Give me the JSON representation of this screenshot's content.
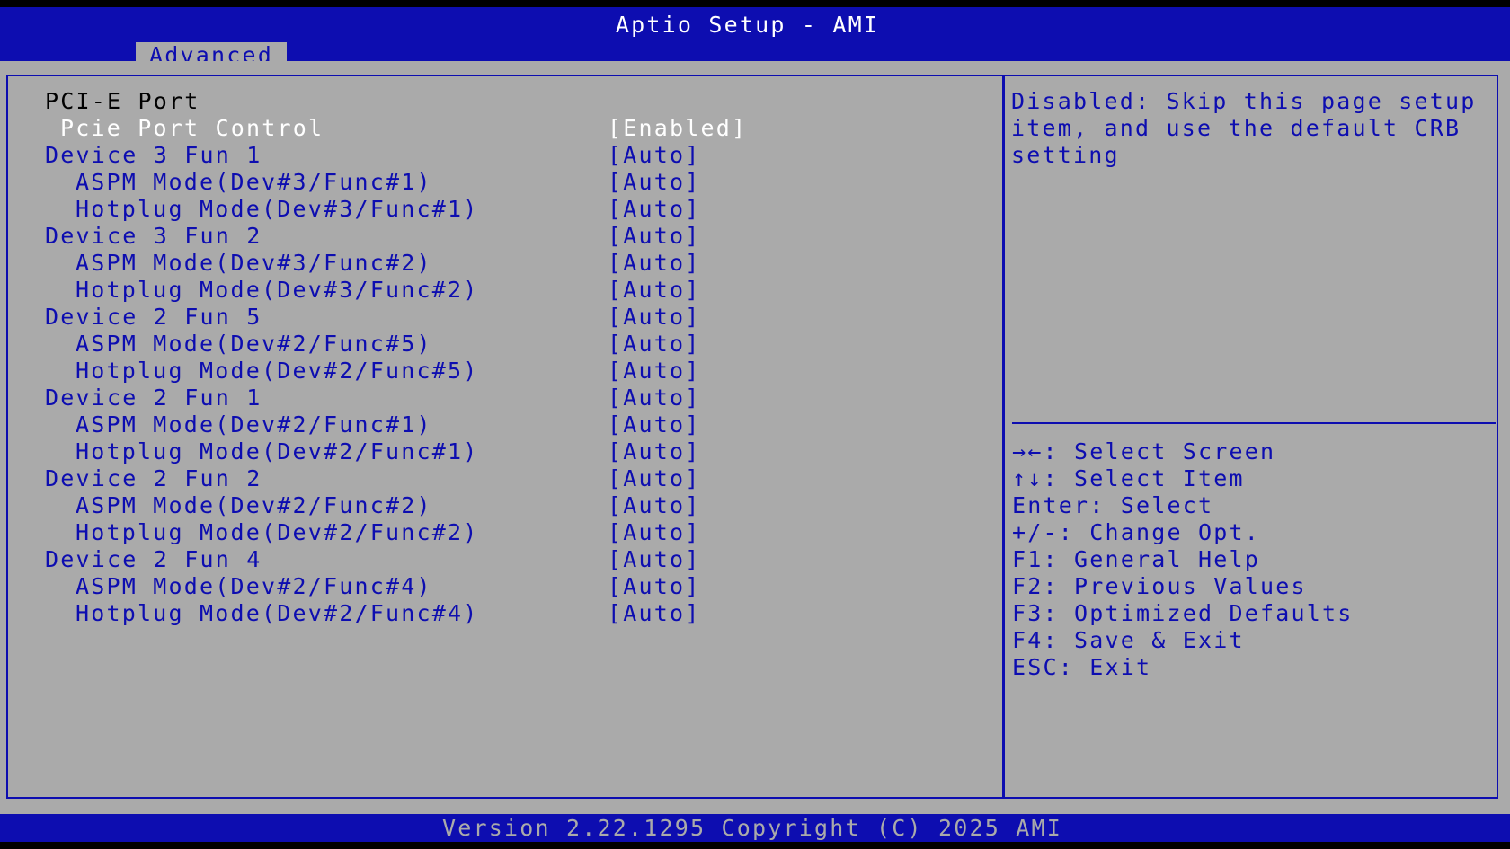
{
  "header": {
    "title": "Aptio Setup - AMI",
    "active_tab": "Advanced"
  },
  "settings": {
    "section_title": "PCI-E Port",
    "items": [
      {
        "label": "Pcie Port Control",
        "value": "[Enabled]",
        "indent": 1,
        "selected": true
      },
      {
        "label": "Device 3 Fun 1",
        "value": "[Auto]",
        "indent": 0
      },
      {
        "label": "ASPM Mode(Dev#3/Func#1)",
        "value": "[Auto]",
        "indent": 2
      },
      {
        "label": "Hotplug Mode(Dev#3/Func#1)",
        "value": "[Auto]",
        "indent": 2
      },
      {
        "label": "Device 3 Fun 2",
        "value": "[Auto]",
        "indent": 0
      },
      {
        "label": "ASPM Mode(Dev#3/Func#2)",
        "value": "[Auto]",
        "indent": 2
      },
      {
        "label": "Hotplug Mode(Dev#3/Func#2)",
        "value": "[Auto]",
        "indent": 2
      },
      {
        "label": "Device 2 Fun 5",
        "value": "[Auto]",
        "indent": 0
      },
      {
        "label": "ASPM Mode(Dev#2/Func#5)",
        "value": "[Auto]",
        "indent": 2
      },
      {
        "label": "Hotplug Mode(Dev#2/Func#5)",
        "value": "[Auto]",
        "indent": 2
      },
      {
        "label": "Device 2 Fun 1",
        "value": "[Auto]",
        "indent": 0
      },
      {
        "label": "ASPM Mode(Dev#2/Func#1)",
        "value": "[Auto]",
        "indent": 2
      },
      {
        "label": "Hotplug Mode(Dev#2/Func#1)",
        "value": "[Auto]",
        "indent": 2
      },
      {
        "label": "Device 2 Fun 2",
        "value": "[Auto]",
        "indent": 0
      },
      {
        "label": "ASPM Mode(Dev#2/Func#2)",
        "value": "[Auto]",
        "indent": 2
      },
      {
        "label": "Hotplug Mode(Dev#2/Func#2)",
        "value": "[Auto]",
        "indent": 2
      },
      {
        "label": "Device 2 Fun 4",
        "value": "[Auto]",
        "indent": 0
      },
      {
        "label": "ASPM Mode(Dev#2/Func#4)",
        "value": "[Auto]",
        "indent": 2
      },
      {
        "label": "Hotplug Mode(Dev#2/Func#4)",
        "value": "[Auto]",
        "indent": 2
      }
    ]
  },
  "help": {
    "description": "Disabled: Skip this page setup item, and use the default CRB setting",
    "keys": [
      "→←: Select Screen",
      "↑↓: Select Item",
      "Enter: Select",
      "+/-: Change Opt.",
      "F1: General Help",
      "F2: Previous Values",
      "F3: Optimized Defaults",
      "F4: Save & Exit",
      "ESC: Exit"
    ]
  },
  "footer": {
    "version": "Version 2.22.1295 Copyright (C) 2025 AMI"
  },
  "colors": {
    "bios_blue": "#0d0db0",
    "panel_gray": "#aaaaaa",
    "highlight_white": "#ffffff"
  }
}
